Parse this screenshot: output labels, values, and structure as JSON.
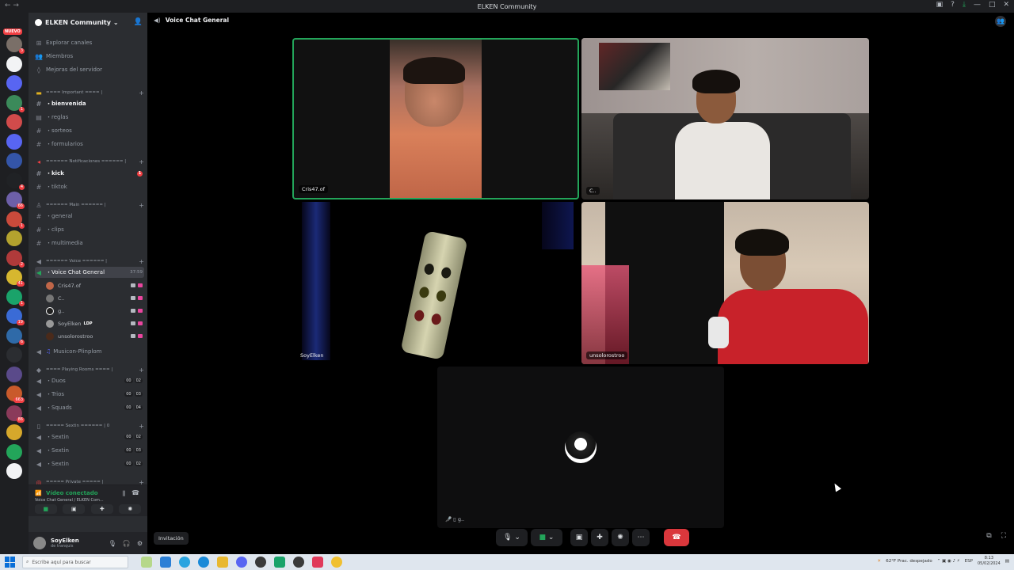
{
  "window": {
    "title": "ELKEN Community"
  },
  "servers": {
    "new_badge": "NUEVO",
    "items": [
      {
        "color": "#7a6f68",
        "badge": "3"
      },
      {
        "color": "#f2f3f5",
        "badge": ""
      },
      {
        "color": "#5865f2",
        "badge": ""
      },
      {
        "color": "#3b8a5a",
        "badge": "1"
      },
      {
        "color": "#d14b4b",
        "badge": ""
      },
      {
        "color": "#5865f2",
        "badge": ""
      },
      {
        "color": "#3455a8",
        "badge": ""
      },
      {
        "color": "#202225",
        "badge": "4"
      },
      {
        "color": "#6d5fa8",
        "badge": "66"
      },
      {
        "color": "#c94a3b",
        "badge": "1"
      },
      {
        "color": "#b3a22e",
        "badge": ""
      },
      {
        "color": "#b03a3a",
        "badge": "2"
      },
      {
        "color": "#d6b72f",
        "badge": "41"
      },
      {
        "color": "#1aa36a",
        "badge": "1"
      },
      {
        "color": "#3a6bd6",
        "badge": "19"
      },
      {
        "color": "#2f6aa8",
        "badge": "6"
      },
      {
        "color": "#2b2d31",
        "badge": ""
      },
      {
        "color": "#5a4a8a",
        "badge": ""
      },
      {
        "color": "#c95a2b",
        "badge": "663"
      },
      {
        "color": "#8a3a5a",
        "badge": "86"
      },
      {
        "color": "#d6a82b",
        "badge": ""
      },
      {
        "color": "#23a55a",
        "badge": ""
      },
      {
        "color": "#f2f3f5",
        "badge": ""
      }
    ]
  },
  "guild": {
    "name": "ELKEN Community"
  },
  "nav": {
    "explore": "Explorar canales",
    "members": "Miembros",
    "boosts": "Mejoras del servidor"
  },
  "categories": {
    "important": "==== Important ==== |",
    "notifications": "====== Notificaciones ====== |",
    "main": "====== Main ====== |",
    "voice": "====== Voice ====== |",
    "playing": "==== Playing Rooms ==== |",
    "sextin": "===== Sextin ====== | 0",
    "private": "===== Private ===== |"
  },
  "channels": {
    "bienvenida": "・bienvenida",
    "reglas": "・reglas",
    "sorteos": "・sorteos",
    "formularios": "・formularios",
    "kick": "・kick",
    "kick_badge": "1",
    "tiktok": "・tiktok",
    "general": "・general",
    "clips": "・clips",
    "multimedia": "・multimedia",
    "voice_chat": "・Voice Chat General",
    "voice_chat_time": "37:59",
    "musicon": "Musicon-Plinplom",
    "duos": "・Duos",
    "duos_cnt": [
      "00",
      "02"
    ],
    "trios": "・Trios",
    "trios_cnt": [
      "00",
      "03"
    ],
    "squads": "・Squads",
    "squads_cnt": [
      "00",
      "04"
    ],
    "sextin1": "・Sextin",
    "sextin1_cnt": [
      "00",
      "02"
    ],
    "sextin2": "・Sextin",
    "sextin2_cnt": [
      "00",
      "03"
    ],
    "sextin3": "・Sextin",
    "sextin3_cnt": [
      "00",
      "02"
    ]
  },
  "voice_members": [
    {
      "name": "Cris47.of",
      "tag": ""
    },
    {
      "name": "C..",
      "tag": ""
    },
    {
      "name": "g..",
      "tag": ""
    },
    {
      "name": "SoyElken",
      "tag": "LDP"
    },
    {
      "name": "unsolorostroo",
      "tag": ""
    }
  ],
  "voice_panel": {
    "status": "Vídeo conectado",
    "sub": "Voice Chat General / ELKEN Com..."
  },
  "user": {
    "name": "SoyElken",
    "status": "de tranquis"
  },
  "header": {
    "channel": "Voice Chat General"
  },
  "tiles": [
    {
      "label": "Cris47.of"
    },
    {
      "label": "C.."
    },
    {
      "label": "SoyElken"
    },
    {
      "label": "unsolorostroo"
    },
    {
      "label": "g.."
    }
  ],
  "invite": "Invitación",
  "taskbar": {
    "search_placeholder": "Escribe aquí para buscar",
    "weather": "62°F  Prac. despejado",
    "time": "8:13",
    "date": "05/02/2024",
    "lang": "ESP"
  }
}
